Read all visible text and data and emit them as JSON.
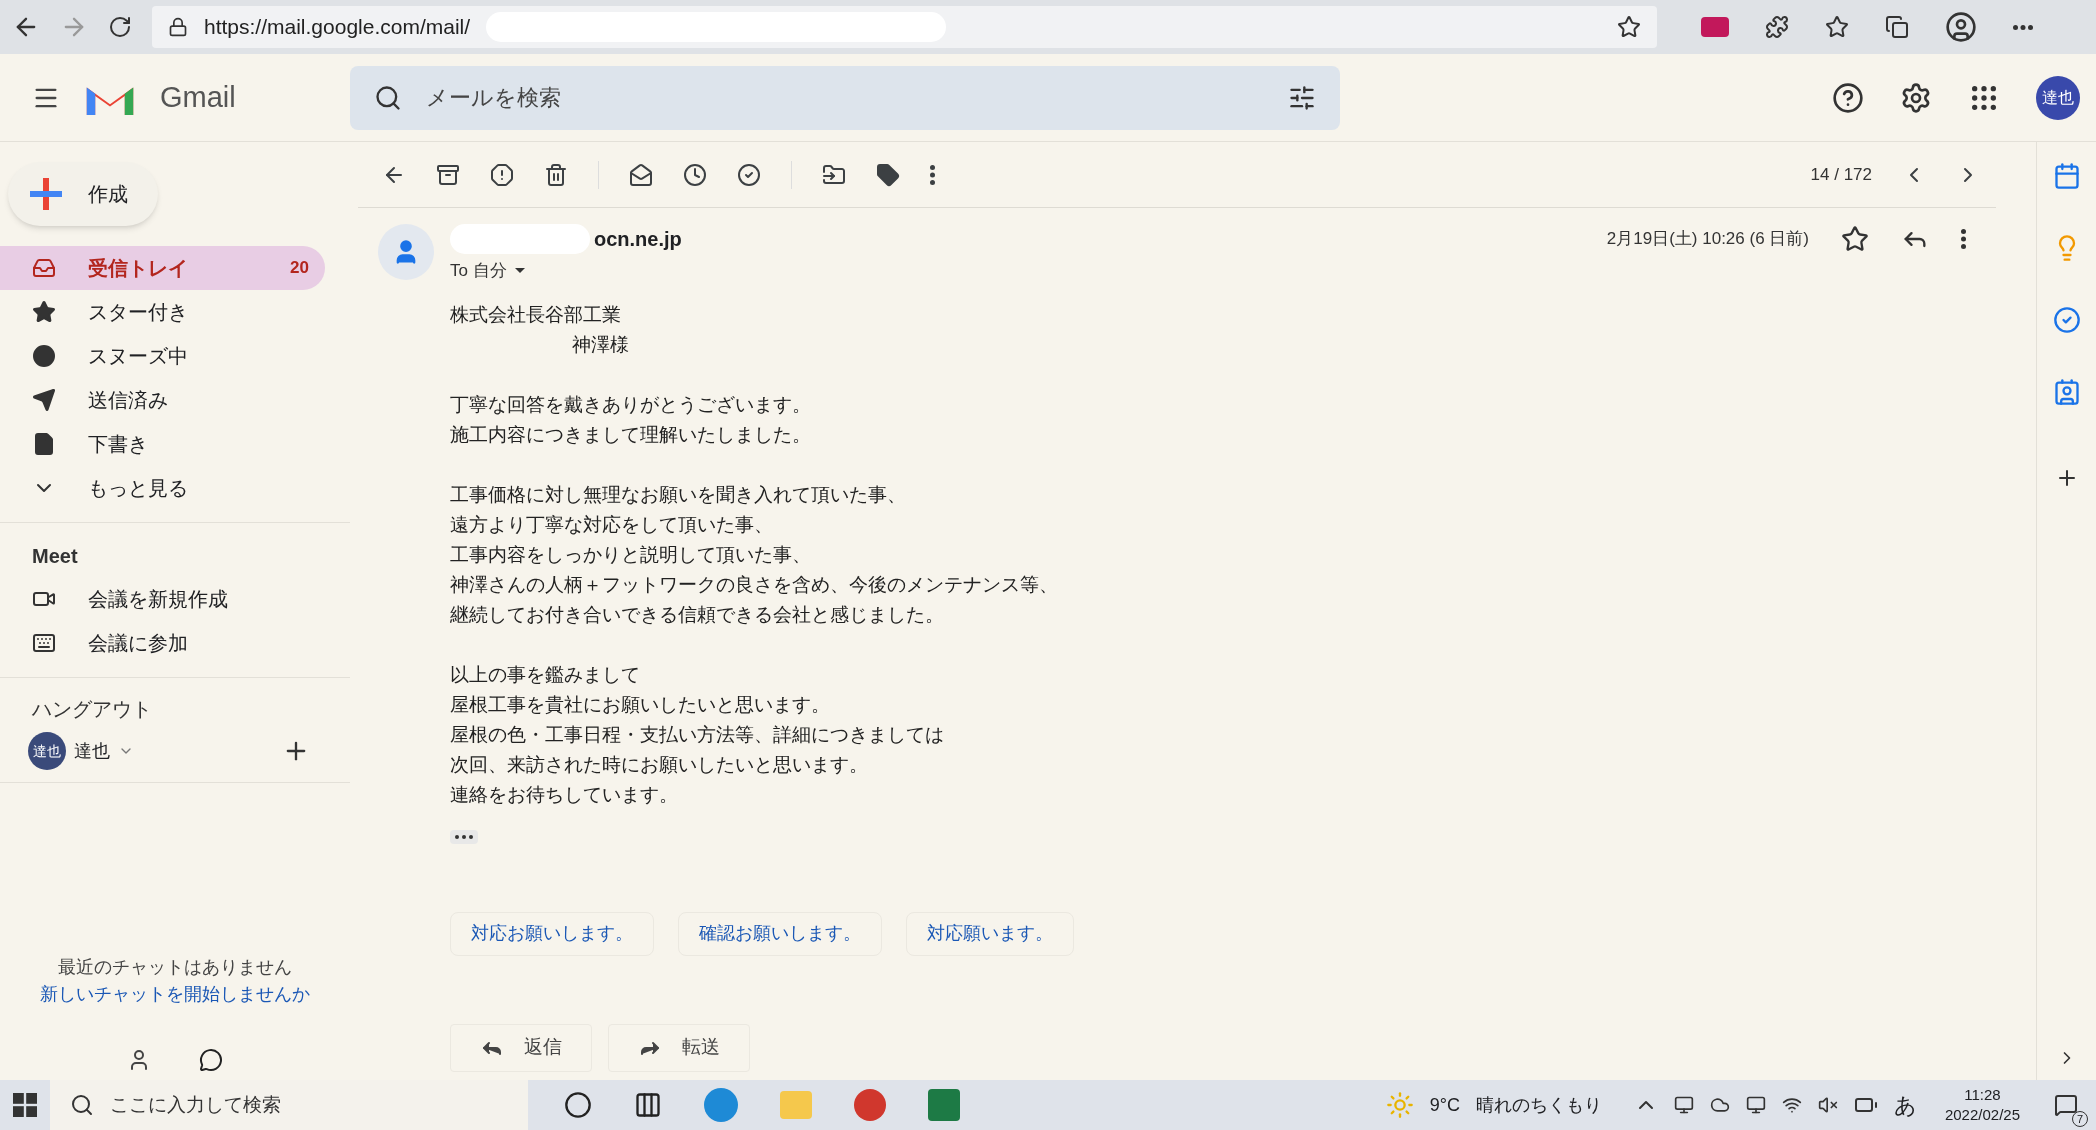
{
  "browser": {
    "url": "https://mail.google.com/mail/"
  },
  "header": {
    "logo_text": "Gmail",
    "search_placeholder": "メールを検索",
    "account_initials": "達也"
  },
  "compose": {
    "label": "作成"
  },
  "sidebar": {
    "items": [
      {
        "kind": "inbox",
        "label": "受信トレイ",
        "count": "20",
        "selected": true
      },
      {
        "kind": "star",
        "label": "スター付き",
        "selected": false
      },
      {
        "kind": "snooze",
        "label": "スヌーズ中",
        "selected": false
      },
      {
        "kind": "sent",
        "label": "送信済み",
        "selected": false
      },
      {
        "kind": "draft",
        "label": "下書き",
        "selected": false
      },
      {
        "kind": "more",
        "label": "もっと見る",
        "selected": false
      }
    ]
  },
  "meet": {
    "title": "Meet",
    "items": [
      {
        "kind": "video",
        "label": "会議を新規作成"
      },
      {
        "kind": "keyboard",
        "label": "会議に参加"
      }
    ]
  },
  "hangouts": {
    "title": "ハングアウト",
    "user": "達也",
    "avatar": "達也",
    "empty_text": "最近のチャットはありません",
    "start_link": "新しいチャットを開始しませんか"
  },
  "toolbar": {
    "counter": "14 / 172"
  },
  "message": {
    "sender": "ocn.ne.jp",
    "to": "To 自分",
    "date": "2月19日(土) 10:26 (6 日前)",
    "starred": false,
    "paragraphs": [
      [
        {
          "text": "株式会社長谷部工業",
          "indent": false
        },
        {
          "text": "神澤様",
          "indent": true
        }
      ],
      [
        {
          "text": "丁寧な回答を戴きありがとうございます。",
          "indent": false
        },
        {
          "text": "施工内容につきまして理解いたしました。",
          "indent": false
        }
      ],
      [
        {
          "text": "工事価格に対し無理なお願いを聞き入れて頂いた事、",
          "indent": false
        },
        {
          "text": "遠方より丁寧な対応をして頂いた事、",
          "indent": false
        },
        {
          "text": "工事内容をしっかりと説明して頂いた事、",
          "indent": false
        },
        {
          "text": "神澤さんの人柄＋フットワークの良さを含め、今後のメンテナンス等、",
          "indent": false
        },
        {
          "text": "継続してお付き合いできる信頼できる会社と感じました。",
          "indent": false
        }
      ],
      [
        {
          "text": "以上の事を鑑みまして",
          "indent": false
        },
        {
          "text": "屋根工事を貴社にお願いしたいと思います。",
          "indent": false
        },
        {
          "text": "屋根の色・工事日程・支払い方法等、詳細につきましては",
          "indent": false
        },
        {
          "text": "次回、来訪された時にお願いしたいと思います。",
          "indent": false
        },
        {
          "text": "連絡をお待ちしています。",
          "indent": false
        }
      ]
    ],
    "smart_replies": [
      "対応お願いします。",
      "確認お願いします。",
      "対応願います。"
    ],
    "actions": [
      {
        "kind": "reply",
        "label": "返信"
      },
      {
        "kind": "forward",
        "label": "転送"
      }
    ]
  },
  "taskbar": {
    "search_placeholder": "ここに入力して検索",
    "temperature": "9°C",
    "weather": "晴れのちくもり",
    "ime": "あ",
    "time": "11:28",
    "date": "2022/02/25",
    "notification_count": "7"
  }
}
